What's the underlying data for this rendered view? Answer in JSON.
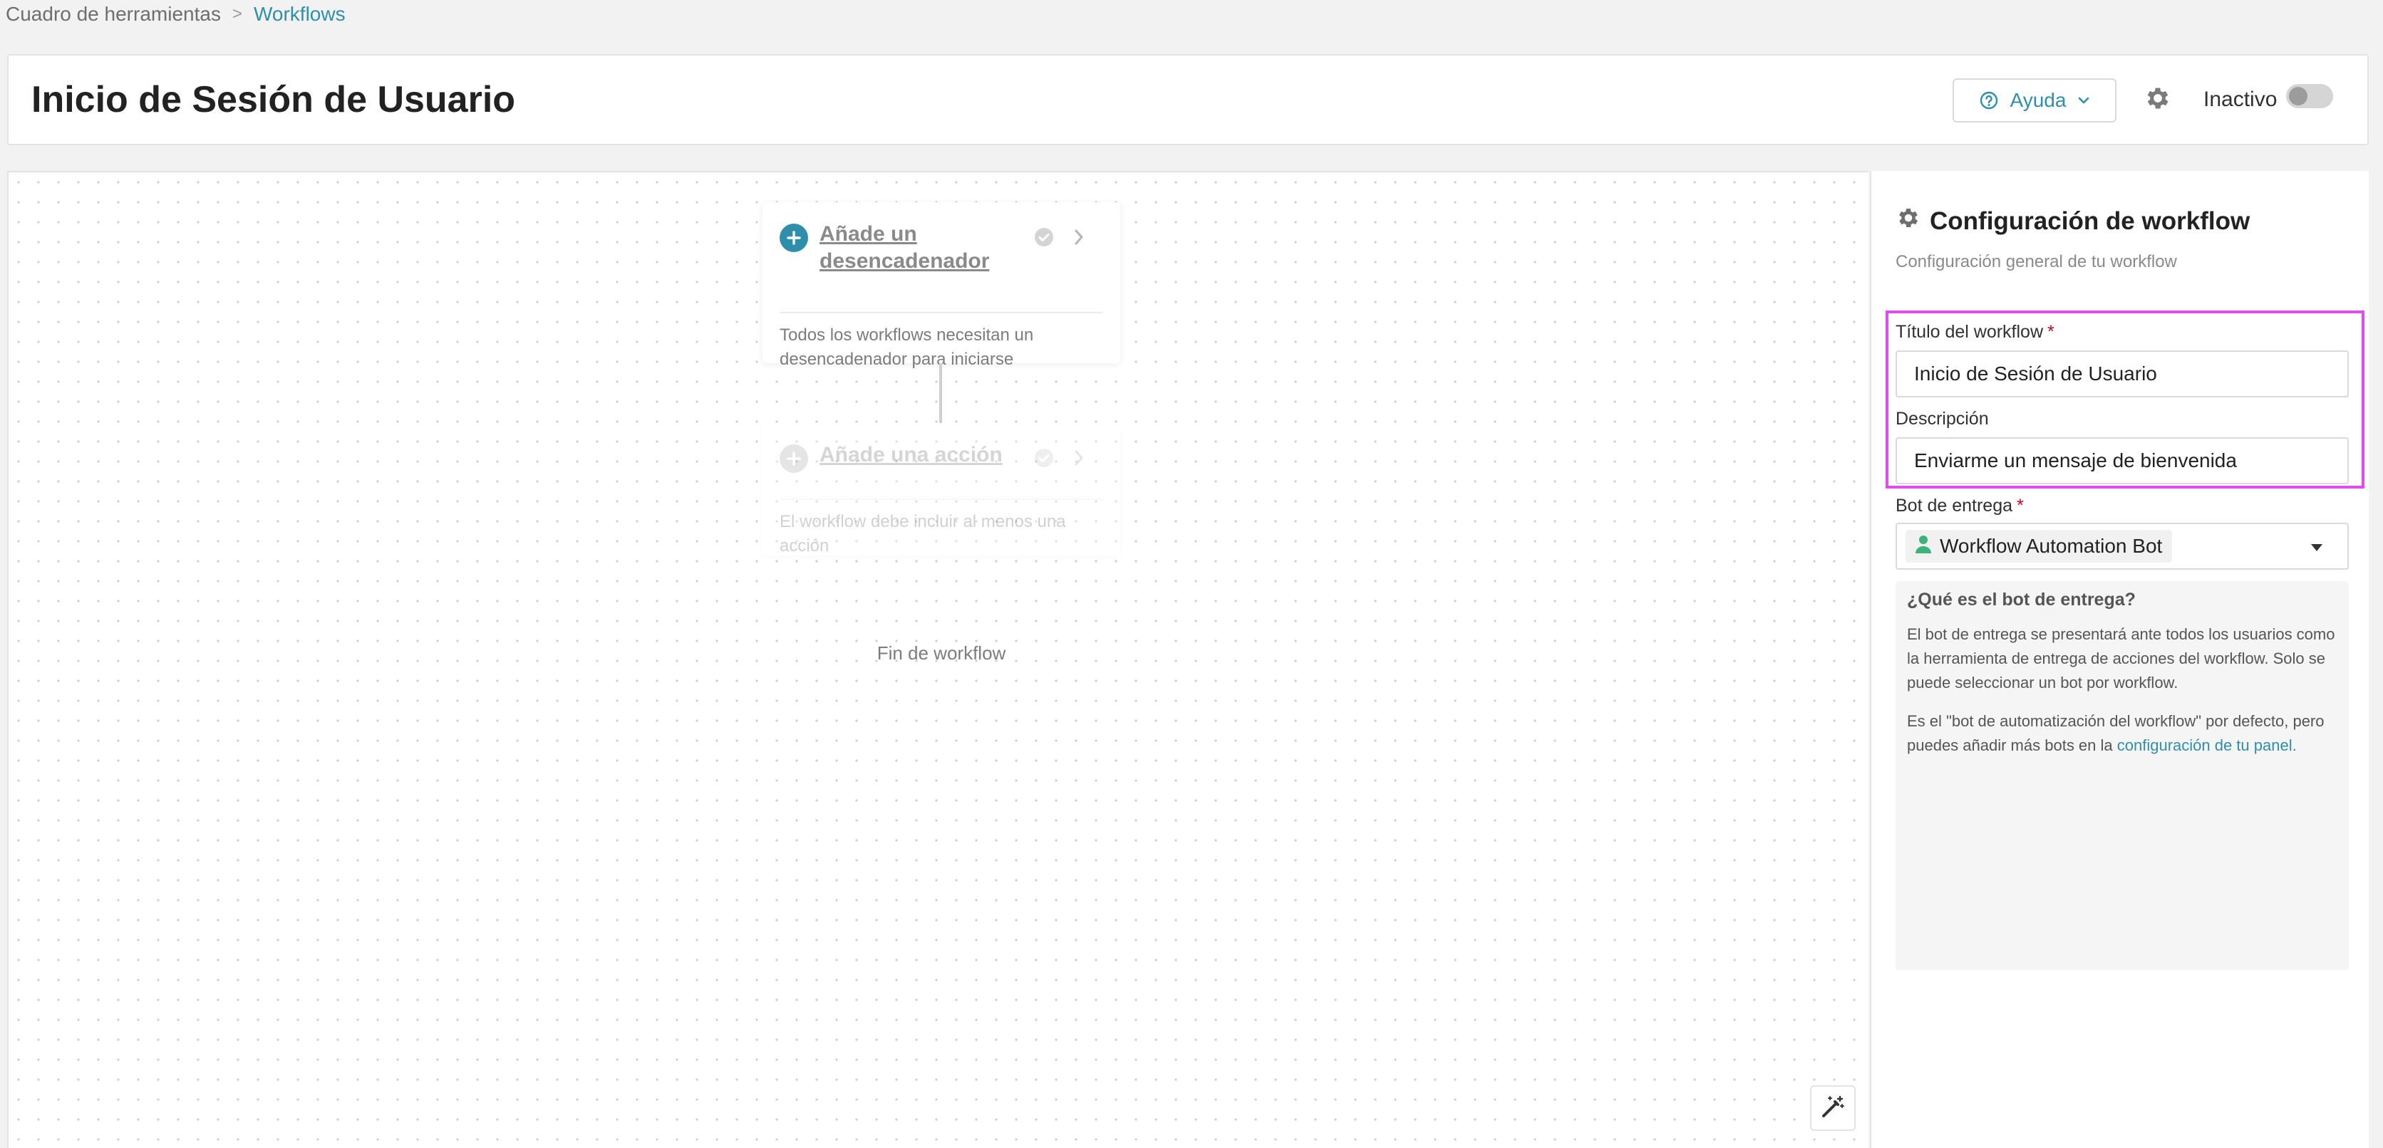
{
  "breadcrumb": {
    "parent": "Cuadro de herramientas",
    "separator": ">",
    "current": "Workflows"
  },
  "header": {
    "title": "Inicio de Sesión de Usuario",
    "help_label": "Ayuda",
    "status_label": "Inactivo",
    "status_active": false
  },
  "canvas": {
    "trigger": {
      "title": "Añade un desencadenador",
      "description": "Todos los workflows necesitan un desencadenador para iniciarse"
    },
    "action": {
      "title": "Añade una acción",
      "description": "El workflow debe incluir al menos una acción"
    },
    "end_label": "Fin de workflow"
  },
  "panel": {
    "title": "Configuración de workflow",
    "subtitle": "Configuración general de tu workflow",
    "title_field": {
      "label": "Título del workflow",
      "required_mark": "*",
      "value": "Inicio de Sesión de Usuario"
    },
    "description_field": {
      "label": "Descripción",
      "value": "Enviarme un mensaje de bienvenida"
    },
    "bot_field": {
      "label": "Bot de entrega",
      "required_mark": "*",
      "value": "Workflow Automation Bot"
    },
    "info": {
      "question": "¿Qué es el bot de entrega?",
      "paragraph1": "El bot de entrega se presentará ante todos los usuarios como la herramienta de entrega de acciones del workflow. Solo se puede seleccionar un bot por workflow.",
      "paragraph2_prefix": "Es el \"bot de automatización del workflow\" por defecto, pero puedes añadir más bots en la ",
      "paragraph2_link": "configuración de tu panel."
    }
  },
  "colors": {
    "accent": "#2f8fab",
    "highlight": "#e14cf2",
    "required": "#d0021b",
    "bot_icon": "#3bb37a"
  }
}
